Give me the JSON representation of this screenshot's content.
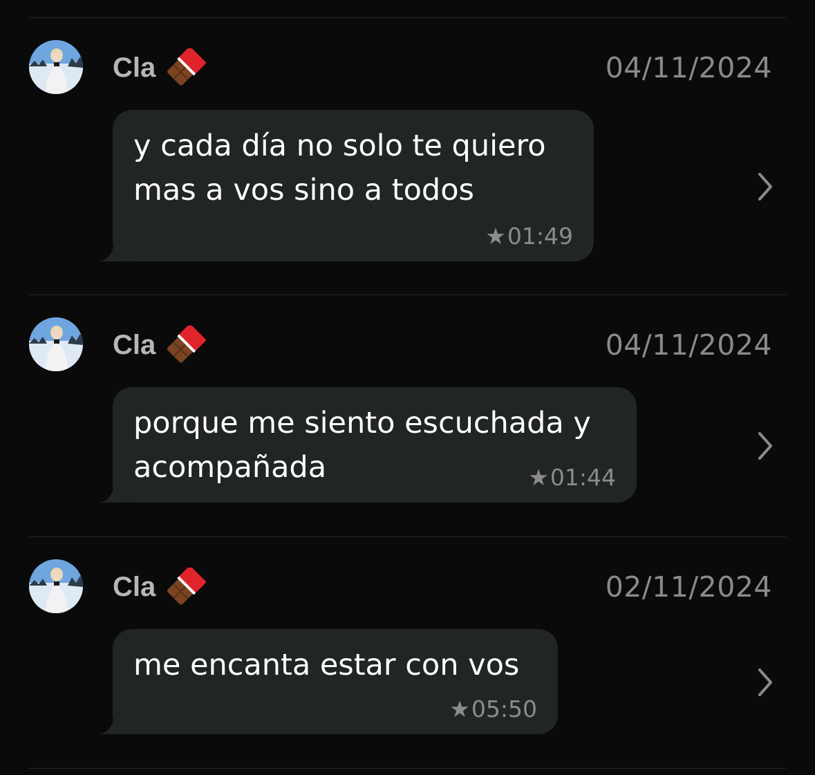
{
  "messages": [
    {
      "sender": "Cla",
      "sender_emoji_icon": "chocolate-bar-icon",
      "date": "04/11/2024",
      "text_lines": [
        "y cada día no solo te quiero",
        "mas a vos sino a todos"
      ],
      "starred": true,
      "star_icon": "★",
      "time": "01:49",
      "chevron_icon": "chevron-right-icon"
    },
    {
      "sender": "Cla",
      "sender_emoji_icon": "chocolate-bar-icon",
      "date": "04/11/2024",
      "text_lines": [
        "porque me siento escuchada y",
        "acompañada"
      ],
      "starred": true,
      "star_icon": "★",
      "time": "01:44",
      "chevron_icon": "chevron-right-icon"
    },
    {
      "sender": "Cla",
      "sender_emoji_icon": "chocolate-bar-icon",
      "date": "02/11/2024",
      "text_lines": [
        "me encanta estar con vos"
      ],
      "starred": true,
      "star_icon": "★",
      "time": "05:50",
      "chevron_icon": "chevron-right-icon"
    }
  ],
  "colors": {
    "background": "#0a0a0a",
    "bubble": "#222526",
    "sender_name": "#b6b6b6",
    "date": "#8a8a8a",
    "meta": "#8c8c8c",
    "divider": "#262626"
  }
}
